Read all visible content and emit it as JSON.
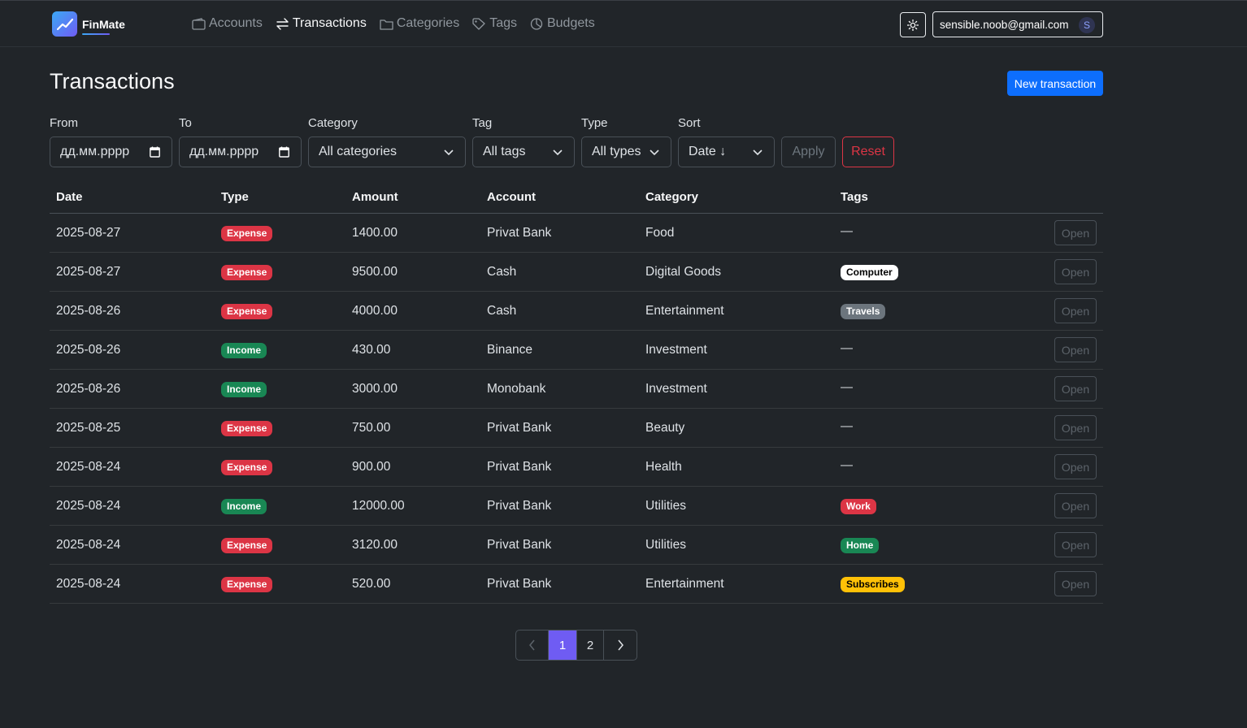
{
  "header": {
    "brand": "FinMate",
    "nav": [
      {
        "label": "Accounts",
        "icon": "wallet-icon",
        "active": false
      },
      {
        "label": "Transactions",
        "icon": "arrows-exchange-icon",
        "active": true
      },
      {
        "label": "Categories",
        "icon": "folder-icon",
        "active": false
      },
      {
        "label": "Tags",
        "icon": "tag-icon",
        "active": false
      },
      {
        "label": "Budgets",
        "icon": "pie-chart-icon",
        "active": false
      }
    ],
    "user_email": "sensible.noob@gmail.com",
    "user_initial": "S"
  },
  "page": {
    "title": "Transactions",
    "new_button": "New transaction"
  },
  "filters": {
    "from_label": "From",
    "from_placeholder": "дд.мм.рррр",
    "to_label": "To",
    "to_placeholder": "дд.мм.рррр",
    "category_label": "Category",
    "category_value": "All categories",
    "tag_label": "Tag",
    "tag_value": "All tags",
    "type_label": "Type",
    "type_value": "All types",
    "sort_label": "Sort",
    "sort_value": "Date ↓",
    "apply": "Apply",
    "reset": "Reset"
  },
  "table": {
    "headers": [
      "Date",
      "Type",
      "Amount",
      "Account",
      "Category",
      "Tags"
    ],
    "open_label": "Open",
    "rows": [
      {
        "date": "2025-08-27",
        "type": "Expense",
        "amount": "1400.00",
        "account": "Privat Bank",
        "category": "Food",
        "tag": "—",
        "tag_color": ""
      },
      {
        "date": "2025-08-27",
        "type": "Expense",
        "amount": "9500.00",
        "account": "Cash",
        "category": "Digital Goods",
        "tag": "Computer",
        "tag_color": "#ffffff"
      },
      {
        "date": "2025-08-26",
        "type": "Expense",
        "amount": "4000.00",
        "account": "Cash",
        "category": "Entertainment",
        "tag": "Travels",
        "tag_color": "#6c757d"
      },
      {
        "date": "2025-08-26",
        "type": "Income",
        "amount": "430.00",
        "account": "Binance",
        "category": "Investment",
        "tag": "—",
        "tag_color": ""
      },
      {
        "date": "2025-08-26",
        "type": "Income",
        "amount": "3000.00",
        "account": "Monobank",
        "category": "Investment",
        "tag": "—",
        "tag_color": ""
      },
      {
        "date": "2025-08-25",
        "type": "Expense",
        "amount": "750.00",
        "account": "Privat Bank",
        "category": "Beauty",
        "tag": "—",
        "tag_color": ""
      },
      {
        "date": "2025-08-24",
        "type": "Expense",
        "amount": "900.00",
        "account": "Privat Bank",
        "category": "Health",
        "tag": "—",
        "tag_color": ""
      },
      {
        "date": "2025-08-24",
        "type": "Income",
        "amount": "12000.00",
        "account": "Privat Bank",
        "category": "Utilities",
        "tag": "Work",
        "tag_color": "#dc3545"
      },
      {
        "date": "2025-08-24",
        "type": "Expense",
        "amount": "3120.00",
        "account": "Privat Bank",
        "category": "Utilities",
        "tag": "Home",
        "tag_color": "#198754"
      },
      {
        "date": "2025-08-24",
        "type": "Expense",
        "amount": "520.00",
        "account": "Privat Bank",
        "category": "Entertainment",
        "tag": "Subscribes",
        "tag_color": "#ffc107"
      }
    ]
  },
  "pagination": {
    "prev": "‹",
    "pages": [
      "1",
      "2"
    ],
    "current": "1",
    "next": "›"
  },
  "colors": {
    "background": "#212529",
    "primary": "#0d6efd",
    "accent": "#6f5cf3",
    "expense": "#dc3545",
    "income": "#198754"
  }
}
